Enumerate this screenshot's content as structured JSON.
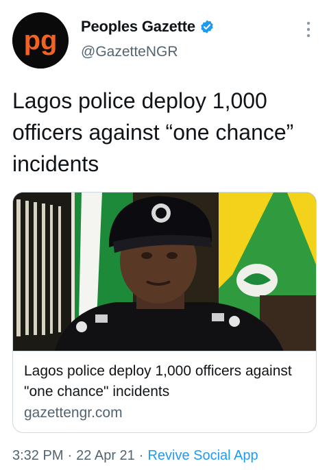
{
  "tweet": {
    "author": {
      "display_name": "Peoples Gazette",
      "handle": "@GazetteNGR",
      "avatar_text": "pg",
      "avatar_icon": "peoples-gazette-logo",
      "verified_icon": "verified-badge-icon"
    },
    "more_icon": "more-vertical-icon",
    "text": "Lagos police deploy 1,000 officers against “one chance” incidents",
    "card": {
      "image_icon": "police-officer-photo",
      "title": "Lagos police deploy 1,000 officers against \"one chance\" incidents",
      "domain": "gazettengr.com"
    },
    "time": "3:32 PM",
    "date": "22 Apr 21",
    "source": "Revive Social App",
    "separator": "·"
  },
  "colors": {
    "text_primary": "#0f1419",
    "text_secondary": "#536471",
    "link": "#1d9bf0",
    "logo_orange": "#f26322",
    "border": "#cfd9de"
  }
}
